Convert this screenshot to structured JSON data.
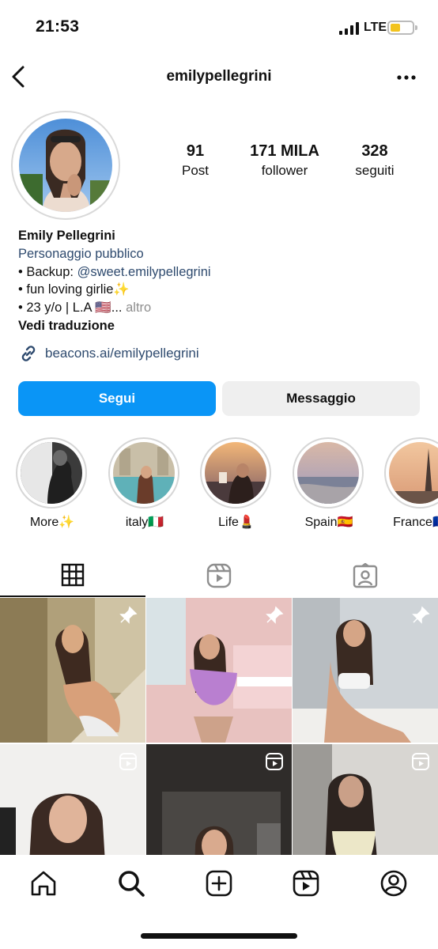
{
  "status_bar": {
    "time": "21:53",
    "network": "LTE"
  },
  "header": {
    "username": "emilypellegrini"
  },
  "stats": [
    {
      "value": "91",
      "label": "Post"
    },
    {
      "value": "171 MILA",
      "label": "follower"
    },
    {
      "value": "328",
      "label": "seguiti"
    }
  ],
  "bio": {
    "name": "Emily Pellegrini",
    "category": "Personaggio pubblico",
    "line1_prefix": "• Backup: ",
    "line1_handle": "@sweet.emilypellegrini",
    "line2": "• fun loving girlie✨",
    "line3": "• 23 y/o | L.A 🇺🇸...",
    "more": "altro",
    "translate": "Vedi traduzione",
    "link": "beacons.ai/emilypellegrini"
  },
  "buttons": {
    "follow": "Segui",
    "message": "Messaggio"
  },
  "highlights": [
    {
      "label": "More✨"
    },
    {
      "label": "italy🇮🇹"
    },
    {
      "label": "Life💄"
    },
    {
      "label": "Spain🇪🇸"
    },
    {
      "label": "France🇫🇷"
    }
  ],
  "tabs": [
    "grid-icon",
    "reels-icon",
    "tagged-icon"
  ],
  "nav": [
    "home-icon",
    "search-icon",
    "create-icon",
    "reels-icon",
    "profile-icon"
  ],
  "colors": {
    "primary_button": "#0a95f6",
    "link": "#2e4a6e",
    "battery": "#f2c31e"
  }
}
